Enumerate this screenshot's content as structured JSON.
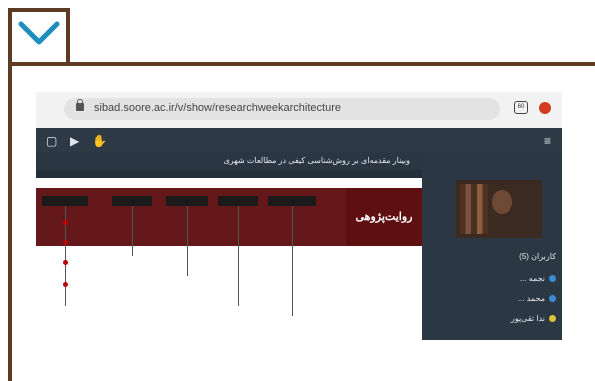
{
  "browser": {
    "url": "sibad.soore.ac.ir/v/show/researchweekarchitecture",
    "tab_icon_label": "60"
  },
  "meeting": {
    "title": "وبینار مقدمه‌ای بر روش‌شناسی کیفی در مطالعات شهری",
    "slide_title": "روایت‌پژوهی",
    "users_header": "کاربران (5)",
    "users": [
      {
        "name": "نجمه ...",
        "color": "#3d8bd8"
      },
      {
        "name": "محمد ...",
        "color": "#3d8bd8"
      },
      {
        "name": "ندا تقی‌پور",
        "color": "#e0c13b"
      }
    ]
  },
  "colors": {
    "frame": "#5c3a24",
    "accent": "#1c8fbf",
    "slide_banner": "#5e0f10"
  }
}
